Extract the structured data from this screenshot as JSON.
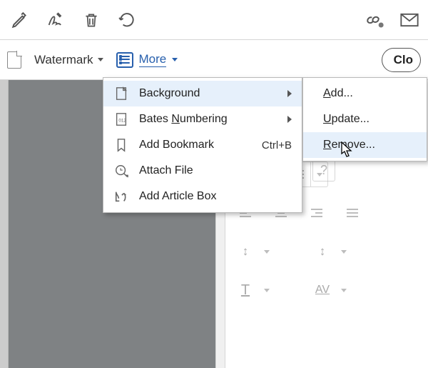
{
  "toolbar": {
    "icons": [
      "pencil-icon",
      "signature-icon",
      "trash-icon",
      "redo-icon",
      "link-cloud-icon",
      "mail-icon"
    ]
  },
  "secondbar": {
    "watermark_label": "Watermark",
    "more_label": "More",
    "close_label": "Clo"
  },
  "more_menu": {
    "items": [
      {
        "label": "Background",
        "has_sub": true,
        "hover": true
      },
      {
        "label": "Bates Numbering",
        "underline_idx": 6,
        "has_sub": true
      },
      {
        "label": "Add Bookmark",
        "accel": "Ctrl+B"
      },
      {
        "label": "Attach File"
      },
      {
        "label": "Add Article Box"
      }
    ]
  },
  "sub_menu": {
    "items": [
      {
        "label": "Add...",
        "underline_idx": 0
      },
      {
        "label": "Update...",
        "underline_idx": 0
      },
      {
        "label": "Remove...",
        "underline_idx": 0,
        "hover": true
      }
    ]
  },
  "right_panel": {
    "help": "?"
  }
}
